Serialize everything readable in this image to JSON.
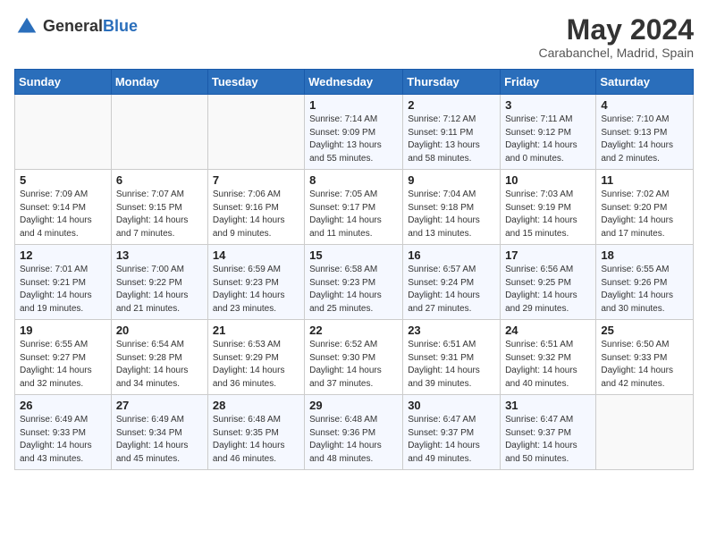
{
  "header": {
    "logo_general": "General",
    "logo_blue": "Blue",
    "title": "May 2024",
    "subtitle": "Carabanchel, Madrid, Spain"
  },
  "weekdays": [
    "Sunday",
    "Monday",
    "Tuesday",
    "Wednesday",
    "Thursday",
    "Friday",
    "Saturday"
  ],
  "weeks": [
    [
      {
        "day": "",
        "sunrise": "",
        "sunset": "",
        "daylight": ""
      },
      {
        "day": "",
        "sunrise": "",
        "sunset": "",
        "daylight": ""
      },
      {
        "day": "",
        "sunrise": "",
        "sunset": "",
        "daylight": ""
      },
      {
        "day": "1",
        "sunrise": "Sunrise: 7:14 AM",
        "sunset": "Sunset: 9:09 PM",
        "daylight": "Daylight: 13 hours and 55 minutes."
      },
      {
        "day": "2",
        "sunrise": "Sunrise: 7:12 AM",
        "sunset": "Sunset: 9:11 PM",
        "daylight": "Daylight: 13 hours and 58 minutes."
      },
      {
        "day": "3",
        "sunrise": "Sunrise: 7:11 AM",
        "sunset": "Sunset: 9:12 PM",
        "daylight": "Daylight: 14 hours and 0 minutes."
      },
      {
        "day": "4",
        "sunrise": "Sunrise: 7:10 AM",
        "sunset": "Sunset: 9:13 PM",
        "daylight": "Daylight: 14 hours and 2 minutes."
      }
    ],
    [
      {
        "day": "5",
        "sunrise": "Sunrise: 7:09 AM",
        "sunset": "Sunset: 9:14 PM",
        "daylight": "Daylight: 14 hours and 4 minutes."
      },
      {
        "day": "6",
        "sunrise": "Sunrise: 7:07 AM",
        "sunset": "Sunset: 9:15 PM",
        "daylight": "Daylight: 14 hours and 7 minutes."
      },
      {
        "day": "7",
        "sunrise": "Sunrise: 7:06 AM",
        "sunset": "Sunset: 9:16 PM",
        "daylight": "Daylight: 14 hours and 9 minutes."
      },
      {
        "day": "8",
        "sunrise": "Sunrise: 7:05 AM",
        "sunset": "Sunset: 9:17 PM",
        "daylight": "Daylight: 14 hours and 11 minutes."
      },
      {
        "day": "9",
        "sunrise": "Sunrise: 7:04 AM",
        "sunset": "Sunset: 9:18 PM",
        "daylight": "Daylight: 14 hours and 13 minutes."
      },
      {
        "day": "10",
        "sunrise": "Sunrise: 7:03 AM",
        "sunset": "Sunset: 9:19 PM",
        "daylight": "Daylight: 14 hours and 15 minutes."
      },
      {
        "day": "11",
        "sunrise": "Sunrise: 7:02 AM",
        "sunset": "Sunset: 9:20 PM",
        "daylight": "Daylight: 14 hours and 17 minutes."
      }
    ],
    [
      {
        "day": "12",
        "sunrise": "Sunrise: 7:01 AM",
        "sunset": "Sunset: 9:21 PM",
        "daylight": "Daylight: 14 hours and 19 minutes."
      },
      {
        "day": "13",
        "sunrise": "Sunrise: 7:00 AM",
        "sunset": "Sunset: 9:22 PM",
        "daylight": "Daylight: 14 hours and 21 minutes."
      },
      {
        "day": "14",
        "sunrise": "Sunrise: 6:59 AM",
        "sunset": "Sunset: 9:23 PM",
        "daylight": "Daylight: 14 hours and 23 minutes."
      },
      {
        "day": "15",
        "sunrise": "Sunrise: 6:58 AM",
        "sunset": "Sunset: 9:23 PM",
        "daylight": "Daylight: 14 hours and 25 minutes."
      },
      {
        "day": "16",
        "sunrise": "Sunrise: 6:57 AM",
        "sunset": "Sunset: 9:24 PM",
        "daylight": "Daylight: 14 hours and 27 minutes."
      },
      {
        "day": "17",
        "sunrise": "Sunrise: 6:56 AM",
        "sunset": "Sunset: 9:25 PM",
        "daylight": "Daylight: 14 hours and 29 minutes."
      },
      {
        "day": "18",
        "sunrise": "Sunrise: 6:55 AM",
        "sunset": "Sunset: 9:26 PM",
        "daylight": "Daylight: 14 hours and 30 minutes."
      }
    ],
    [
      {
        "day": "19",
        "sunrise": "Sunrise: 6:55 AM",
        "sunset": "Sunset: 9:27 PM",
        "daylight": "Daylight: 14 hours and 32 minutes."
      },
      {
        "day": "20",
        "sunrise": "Sunrise: 6:54 AM",
        "sunset": "Sunset: 9:28 PM",
        "daylight": "Daylight: 14 hours and 34 minutes."
      },
      {
        "day": "21",
        "sunrise": "Sunrise: 6:53 AM",
        "sunset": "Sunset: 9:29 PM",
        "daylight": "Daylight: 14 hours and 36 minutes."
      },
      {
        "day": "22",
        "sunrise": "Sunrise: 6:52 AM",
        "sunset": "Sunset: 9:30 PM",
        "daylight": "Daylight: 14 hours and 37 minutes."
      },
      {
        "day": "23",
        "sunrise": "Sunrise: 6:51 AM",
        "sunset": "Sunset: 9:31 PM",
        "daylight": "Daylight: 14 hours and 39 minutes."
      },
      {
        "day": "24",
        "sunrise": "Sunrise: 6:51 AM",
        "sunset": "Sunset: 9:32 PM",
        "daylight": "Daylight: 14 hours and 40 minutes."
      },
      {
        "day": "25",
        "sunrise": "Sunrise: 6:50 AM",
        "sunset": "Sunset: 9:33 PM",
        "daylight": "Daylight: 14 hours and 42 minutes."
      }
    ],
    [
      {
        "day": "26",
        "sunrise": "Sunrise: 6:49 AM",
        "sunset": "Sunset: 9:33 PM",
        "daylight": "Daylight: 14 hours and 43 minutes."
      },
      {
        "day": "27",
        "sunrise": "Sunrise: 6:49 AM",
        "sunset": "Sunset: 9:34 PM",
        "daylight": "Daylight: 14 hours and 45 minutes."
      },
      {
        "day": "28",
        "sunrise": "Sunrise: 6:48 AM",
        "sunset": "Sunset: 9:35 PM",
        "daylight": "Daylight: 14 hours and 46 minutes."
      },
      {
        "day": "29",
        "sunrise": "Sunrise: 6:48 AM",
        "sunset": "Sunset: 9:36 PM",
        "daylight": "Daylight: 14 hours and 48 minutes."
      },
      {
        "day": "30",
        "sunrise": "Sunrise: 6:47 AM",
        "sunset": "Sunset: 9:37 PM",
        "daylight": "Daylight: 14 hours and 49 minutes."
      },
      {
        "day": "31",
        "sunrise": "Sunrise: 6:47 AM",
        "sunset": "Sunset: 9:37 PM",
        "daylight": "Daylight: 14 hours and 50 minutes."
      },
      {
        "day": "",
        "sunrise": "",
        "sunset": "",
        "daylight": ""
      }
    ]
  ]
}
